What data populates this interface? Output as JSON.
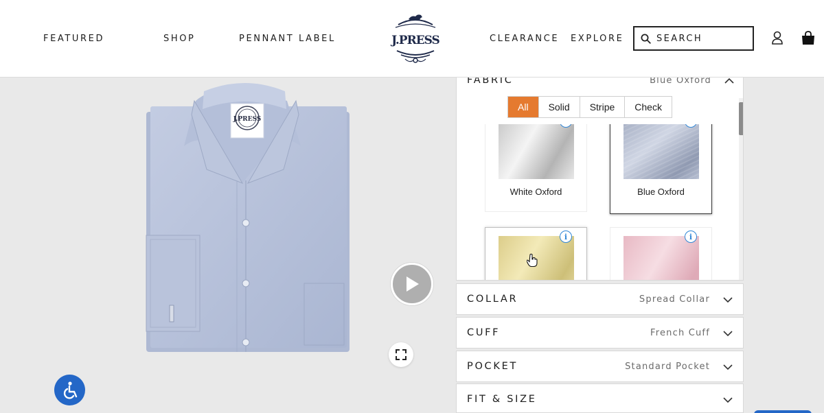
{
  "header": {
    "nav_left": [
      "FEATURED",
      "SHOP",
      "PENNANT LABEL"
    ],
    "nav_right": [
      "CLEARANCE",
      "EXPLORE"
    ],
    "logo_text": "J.PRESS",
    "search_label": "SEARCH",
    "icons": [
      "search-icon",
      "account-icon",
      "bag-icon"
    ]
  },
  "product": {
    "shirt_color": "#b8c4dc",
    "shirt_label_text": "J.PRESS",
    "controls": [
      "play-icon",
      "expand-icon",
      "accessibility-icon"
    ]
  },
  "panel": {
    "fabric": {
      "title": "FABRIC",
      "value": "Blue Oxford",
      "filters": [
        "All",
        "Solid",
        "Stripe",
        "Check"
      ],
      "active_filter": "All",
      "swatches": [
        {
          "name": "White Oxford",
          "selected": false
        },
        {
          "name": "Blue Oxford",
          "selected": true
        },
        {
          "name": "",
          "selected": false
        },
        {
          "name": "",
          "selected": false
        }
      ]
    },
    "sections": [
      {
        "title": "COLLAR",
        "value": "Spread Collar"
      },
      {
        "title": "CUFF",
        "value": "French Cuff"
      },
      {
        "title": "POCKET",
        "value": "Standard Pocket"
      },
      {
        "title": "FIT & SIZE",
        "value": ""
      }
    ]
  },
  "colors": {
    "accent": "#e57a2f",
    "info": "#2f86d6",
    "accessibility": "#2467c7"
  }
}
